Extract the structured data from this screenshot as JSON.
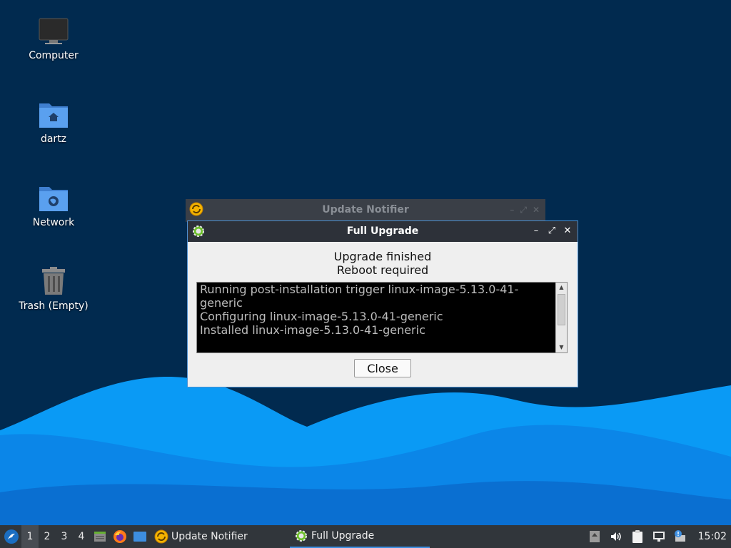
{
  "desktop": {
    "icons": [
      {
        "label": "Computer",
        "icon": "computer-icon"
      },
      {
        "label": "dartz",
        "icon": "home-folder-icon"
      },
      {
        "label": "Network",
        "icon": "network-folder-icon"
      },
      {
        "label": "Trash (Empty)",
        "icon": "trash-icon"
      }
    ]
  },
  "background_window": {
    "title": "Update Notifier",
    "controls": {
      "minimize": "–",
      "maximize": "⤢",
      "close": "✕"
    }
  },
  "dialog": {
    "title": "Full Upgrade",
    "controls": {
      "minimize": "–",
      "maximize": "⤢",
      "close": "✕"
    },
    "status_line_1": "Upgrade finished",
    "status_line_2": "Reboot required",
    "log": "Running post-installation trigger linux-image-5.13.0-41-\ngeneric\nConfiguring linux-image-5.13.0-41-generic\nInstalled linux-image-5.13.0-41-generic",
    "close_label": "Close"
  },
  "taskbar": {
    "workspaces": [
      "1",
      "2",
      "3",
      "4"
    ],
    "active_workspace": "1",
    "tasks": [
      {
        "label": "Update Notifier",
        "icon": "update-notifier-icon"
      },
      {
        "label": "Full Upgrade",
        "icon": "gear-icon"
      }
    ],
    "clock": "15:02"
  },
  "colors": {
    "desktop_bg": "#012a4f",
    "wave_light": "#0a9af5",
    "wave_mid": "#0b7de0",
    "taskbar": "#31363b",
    "window_title": "#2d3139",
    "accent": "#3d8ee0"
  }
}
